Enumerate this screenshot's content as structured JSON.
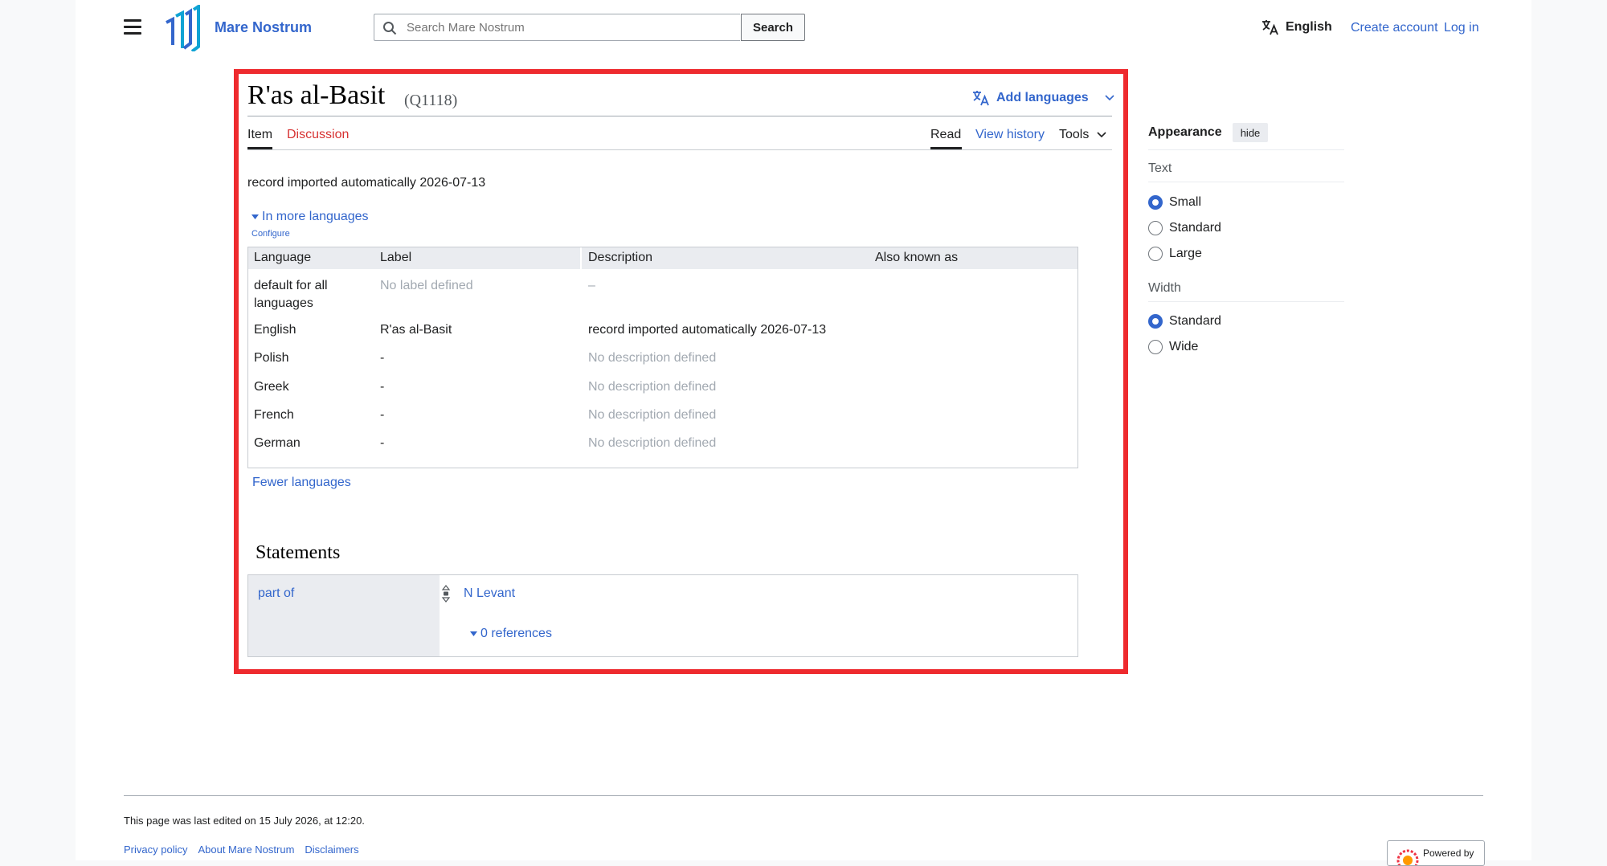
{
  "header": {
    "site_name": "Mare Nostrum",
    "search_placeholder": "Search Mare Nostrum",
    "search_button": "Search",
    "language": "English",
    "create_account": "Create account",
    "login": "Log in"
  },
  "item": {
    "title": "R'as al-Basit",
    "qid": "(Q1118)",
    "add_languages": "Add languages",
    "description": "record imported automatically 2026-07-13"
  },
  "tabs": {
    "item": "Item",
    "discussion": "Discussion",
    "read": "Read",
    "view_history": "View history",
    "tools": "Tools"
  },
  "languages": {
    "toggle": "In more languages",
    "configure": "Configure",
    "headers": [
      "Language",
      "Label",
      "Description",
      "Also known as"
    ],
    "rows": [
      {
        "language": "default for all languages",
        "label": "No label defined",
        "description": "–"
      },
      {
        "language": "English",
        "label": "R'as al-Basit",
        "description": "record imported automatically 2026-07-13"
      },
      {
        "language": "Polish",
        "label": "-",
        "description": "No description defined"
      },
      {
        "language": "Greek",
        "label": "-",
        "description": "No description defined"
      },
      {
        "language": "French",
        "label": "-",
        "description": "No description defined"
      },
      {
        "language": "German",
        "label": "-",
        "description": "No description defined"
      }
    ],
    "fewer": "Fewer languages"
  },
  "statements": {
    "title": "Statements",
    "property": "part of",
    "value": "N Levant",
    "references": "0 references"
  },
  "appearance": {
    "title": "Appearance",
    "hide": "hide",
    "text_label": "Text",
    "text_options": [
      "Small",
      "Standard",
      "Large"
    ],
    "text_selected": "Small",
    "width_label": "Width",
    "width_options": [
      "Standard",
      "Wide"
    ],
    "width_selected": "Standard"
  },
  "footer": {
    "last_edited": "This page was last edited on 15 July 2026, at 12:20.",
    "links": [
      "Privacy policy",
      "About Mare Nostrum",
      "Disclaimers"
    ],
    "powered_by": "Powered by"
  },
  "colors": {
    "link": "#3366cc",
    "discussion": "#d73333",
    "highlight": "#ee2a2e"
  }
}
